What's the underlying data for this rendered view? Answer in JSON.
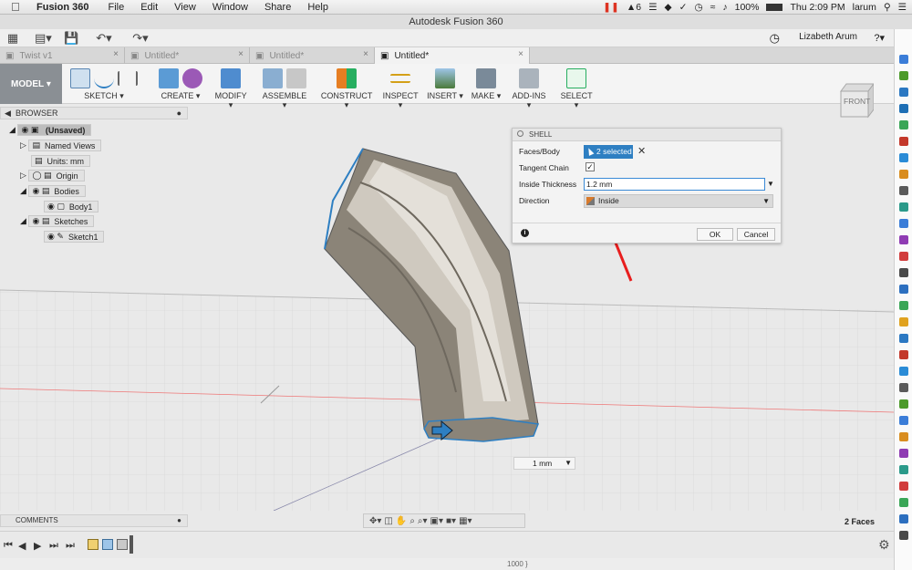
{
  "menubar": {
    "app_name": "Fusion 360",
    "items": [
      "File",
      "Edit",
      "View",
      "Window",
      "Share",
      "Help"
    ],
    "status": {
      "battery": "100%",
      "datetime": "Thu 2:09 PM",
      "user": "larum",
      "badge_count": "6"
    }
  },
  "window": {
    "title": "Autodesk Fusion 360"
  },
  "docbar": {
    "user": "Lizabeth Arum"
  },
  "tabs": [
    {
      "label": "Twist v1"
    },
    {
      "label": "Untitled*"
    },
    {
      "label": "Untitled*"
    },
    {
      "label": "Untitled*"
    }
  ],
  "toolbar": {
    "workspace": "MODEL",
    "groups": [
      "SKETCH",
      "CREATE",
      "MODIFY",
      "ASSEMBLE",
      "CONSTRUCT",
      "INSPECT",
      "INSERT",
      "MAKE",
      "ADD-INS",
      "SELECT"
    ]
  },
  "browser": {
    "title": "BROWSER",
    "items": [
      "(Unsaved)",
      "Named Views",
      "Units: mm",
      "Origin",
      "Bodies",
      "Body1",
      "Sketches",
      "Sketch1"
    ]
  },
  "viewcube": {
    "label": "FRONT"
  },
  "shell": {
    "title": "SHELL",
    "faces_label": "Faces/Body",
    "selected_text": "2 selected",
    "tangent_label": "Tangent Chain",
    "thickness_label": "Inside Thickness",
    "thickness_value": "1.2 mm",
    "direction_label": "Direction",
    "direction_value": "Inside",
    "ok": "OK",
    "cancel": "Cancel"
  },
  "viewport": {
    "distance_value": "1 mm"
  },
  "bottom": {
    "comments": "COMMENTS",
    "status": "2 Faces"
  },
  "footer": {
    "code_text": "1000 }"
  },
  "colors": {
    "selection_blue": "#2e7fc2",
    "annotation_red": "#e81e1e",
    "model_workspace": "#8a8f94"
  }
}
